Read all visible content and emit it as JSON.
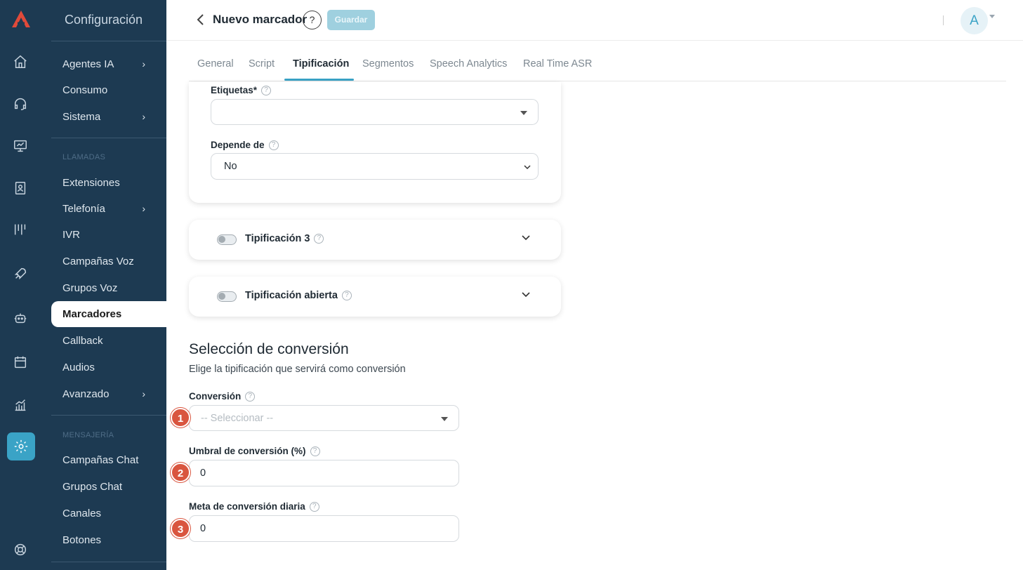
{
  "sidebar": {
    "title": "Configuración",
    "items": [
      {
        "label": "Agentes IA",
        "chevron": true
      },
      {
        "label": "Consumo",
        "chevron": false
      },
      {
        "label": "Sistema",
        "chevron": true
      }
    ],
    "section_llamadas": "LLAMADAS",
    "llamadas_items": [
      {
        "label": "Extensiones",
        "chevron": false
      },
      {
        "label": "Telefonía",
        "chevron": true
      },
      {
        "label": "IVR",
        "chevron": false
      },
      {
        "label": "Campañas Voz",
        "chevron": false
      },
      {
        "label": "Grupos Voz",
        "chevron": false
      },
      {
        "label": "Marcadores",
        "chevron": false,
        "active": true
      },
      {
        "label": "Callback",
        "chevron": false
      },
      {
        "label": "Audios",
        "chevron": false
      },
      {
        "label": "Avanzado",
        "chevron": true
      }
    ],
    "section_mensajeria": "MENSAJERÍA",
    "mensajeria_items": [
      {
        "label": "Campañas Chat"
      },
      {
        "label": "Grupos Chat"
      },
      {
        "label": "Canales"
      },
      {
        "label": "Botones"
      }
    ],
    "chevron_glyph": "›"
  },
  "header": {
    "title": "Nuevo marcador",
    "help": "?",
    "save_label": "Guardar",
    "avatar_initial": "A"
  },
  "tabs": [
    "General",
    "Script",
    "Tipificación",
    "Segmentos",
    "Speech Analytics",
    "Real Time ASR"
  ],
  "active_tab": "Tipificación",
  "form": {
    "etiquetas_label": "Etiquetas*",
    "etiquetas_value": "",
    "depende_label": "Depende de",
    "depende_value": "No",
    "tip3_label": "Tipificación 3",
    "tip_abierta_label": "Tipificación abierta",
    "help_glyph": "?"
  },
  "conversion": {
    "title": "Selección de conversión",
    "subtitle": "Elige la tipificación que servirá como conversión",
    "conversion_label": "Conversión",
    "conversion_placeholder": "-- Seleccionar --",
    "umbral_label": "Umbral de conversión (%)",
    "umbral_value": "0",
    "meta_label": "Meta de conversión diaria",
    "meta_value": "0",
    "badges": [
      "1",
      "2",
      "3"
    ]
  },
  "colors": {
    "sidebar_bg": "#1d3a52",
    "accent": "#3aa3c6",
    "badge": "#d9553f"
  }
}
